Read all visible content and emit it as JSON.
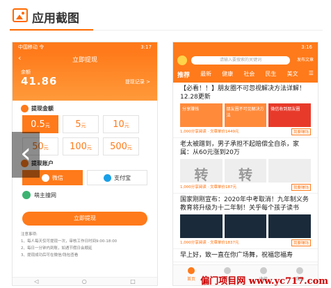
{
  "section": {
    "title": "应用截图"
  },
  "screen1": {
    "status_left": "中国移动 令",
    "status_right": "3:17",
    "title": "立即提现",
    "balance_label": "余额",
    "balance": "41.86",
    "records": "提现记录 >",
    "amount_heading": "提现金额",
    "amounts": [
      {
        "value": "0.5",
        "unit": "元",
        "selected": true
      },
      {
        "value": "5",
        "unit": "元",
        "selected": false
      },
      {
        "value": "10",
        "unit": "元",
        "selected": false
      },
      {
        "value": "50",
        "unit": "元",
        "selected": false
      },
      {
        "value": "100",
        "unit": "元",
        "selected": false
      },
      {
        "value": "500",
        "unit": "元",
        "selected": false
      }
    ],
    "account_heading": "提现账户",
    "pay_wechat": "微信",
    "pay_alipay": "支付宝",
    "wechat_name": "萌主撞网",
    "withdraw_btn": "立即提现",
    "notes_heading": "注意事项:",
    "notes": [
      "1、每人每天仅可提现一次，审核工作日时间9:00-18:00",
      "2、每日一分钟内到账，如遇节假日会顺延",
      "3、提现成功后可在微信/钱包查看"
    ]
  },
  "screen2": {
    "status_right": "3:16",
    "search_placeholder": "请输入要搜索的关键词",
    "publish": "发布文章",
    "tabs": [
      "推荐",
      "最新",
      "健康",
      "社会",
      "民生",
      "美文"
    ],
    "menu_icon": "menu-icon",
    "articles": [
      {
        "title": "【必看！！】朋友圈不可忽视解决方法详解！12.28更新",
        "meta": "1,000分享阅读 · 文章单价1449元",
        "tag": "我要赚钱",
        "thumbs": [
          "分享赚钱",
          "朋友圈不可见解决方法",
          "微信收到朋友圈"
        ]
      },
      {
        "title": "老太被蹭到，男子承担不起赔偿全自杀，家属：从60元涨到20万",
        "meta": "1,000分享阅读 · 文章单价187元",
        "tag": "我要赚钱",
        "thumbs": [
          "转",
          "转",
          ""
        ]
      },
      {
        "title": "国家刚刚宣布：2020年中考取消！九年制义务教育将升级为十二年制！关乎每个孩子读书",
        "meta": "1,000分享阅读 · 文章单价1837元",
        "tag": "我要赚钱"
      },
      {
        "title": "早上好，致一直在你广场舞，祝福您福寿",
        "meta": "",
        "tag": ""
      }
    ],
    "bottom_nav": [
      "首页",
      "任务",
      "收徒",
      "我的"
    ]
  },
  "watermark": "偏门项目网 www.yc717.com"
}
